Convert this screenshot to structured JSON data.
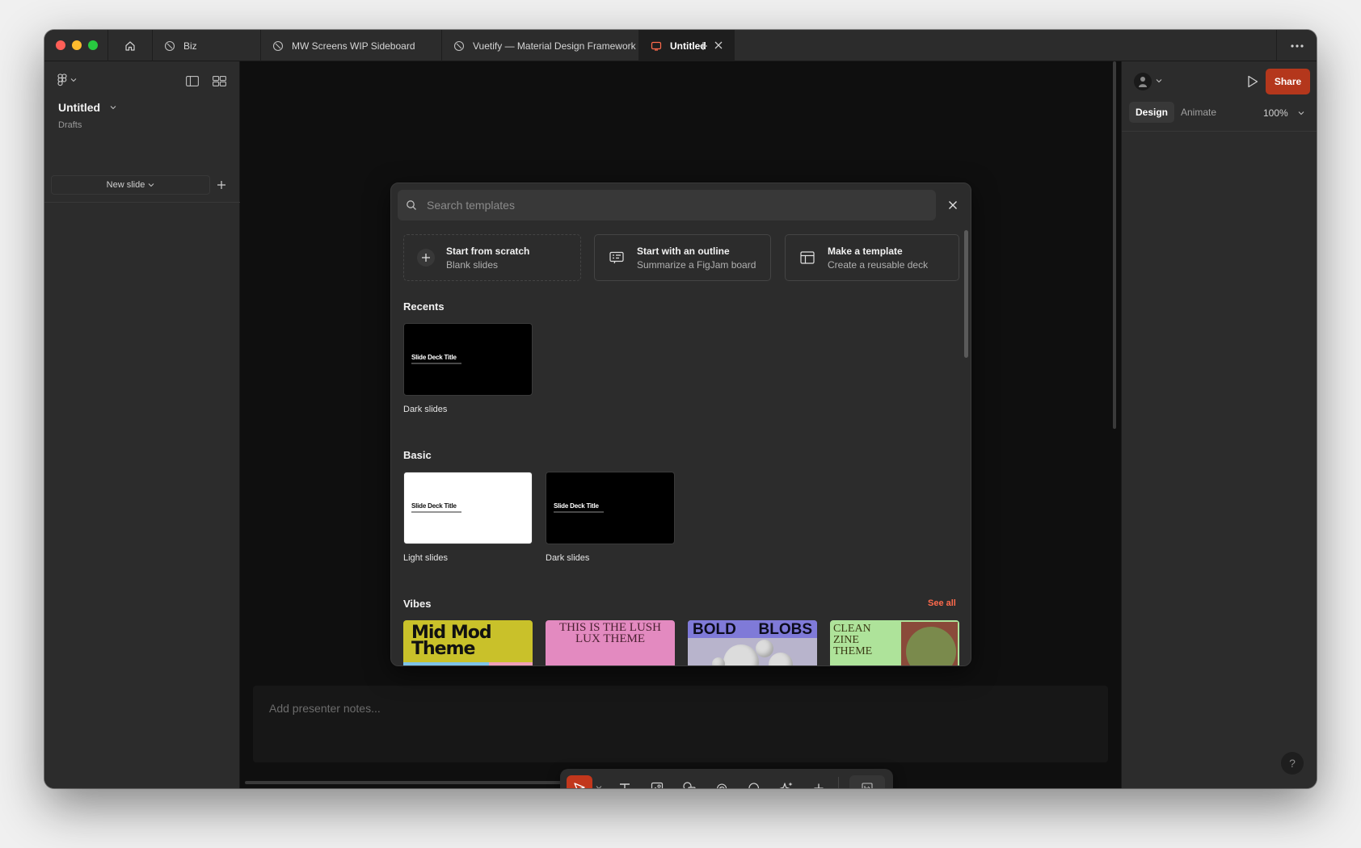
{
  "titlebar": {
    "tabs": [
      {
        "label": "Biz"
      },
      {
        "label": "MW Screens WIP Sideboard"
      },
      {
        "label": "Vuetify — Material Design Framework"
      },
      {
        "label": "Untitled"
      }
    ]
  },
  "left_panel": {
    "file_title": "Untitled",
    "location": "Drafts",
    "new_slide_label": "New slide"
  },
  "canvas": {
    "notes_placeholder": "Add presenter notes..."
  },
  "right_panel": {
    "share_label": "Share",
    "tabs": {
      "design": "Design",
      "animate": "Animate"
    },
    "zoom": "100%",
    "help": "?"
  },
  "modal": {
    "search_placeholder": "Search templates",
    "options": [
      {
        "title": "Start from scratch",
        "subtitle": "Blank slides"
      },
      {
        "title": "Start with an outline",
        "subtitle": "Summarize a FigJam board"
      },
      {
        "title": "Make a template",
        "subtitle": "Create a reusable deck"
      }
    ],
    "recents": {
      "title": "Recents",
      "items": [
        {
          "thumb_title": "Slide Deck Title",
          "label": "Dark slides"
        }
      ]
    },
    "basic": {
      "title": "Basic",
      "items": [
        {
          "thumb_title": "Slide Deck Title",
          "label": "Light slides"
        },
        {
          "thumb_title": "Slide Deck Title",
          "label": "Dark slides"
        }
      ]
    },
    "vibes": {
      "title": "Vibes",
      "see_all": "See all",
      "items": [
        {
          "text": "Mid Mod Theme"
        },
        {
          "text": "THIS IS THE LUSH LUX THEME"
        },
        {
          "text_left": "BOLD",
          "text_right": "BLOBS"
        },
        {
          "text": "CLEAN ZINE THEME"
        }
      ]
    }
  },
  "colors": {
    "accent": "#b4371c",
    "tool_active": "#c2371c",
    "link": "#ff6a4c",
    "panel": "#2c2c2c",
    "canvas": "#0f0f0f"
  }
}
